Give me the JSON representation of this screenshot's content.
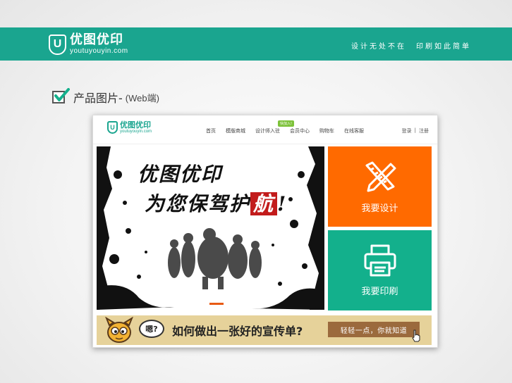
{
  "header": {
    "logo_mark": "U",
    "logo_cn": "优图优印",
    "logo_en": "youtuyouyin.com",
    "slogan_left": "设计无处不在",
    "slogan_right": "印刷如此简单",
    "color": "#1aa58f"
  },
  "section": {
    "title": "产品图片-",
    "subtitle": "(Web端)"
  },
  "inner_site": {
    "logo_cn": "优图优印",
    "logo_en": "youtuyouyin.com",
    "nav": [
      {
        "label": "首页"
      },
      {
        "label": "模版商城"
      },
      {
        "label": "设计师入驻",
        "badge": "快加入!"
      },
      {
        "label": "会员中心"
      },
      {
        "label": "购物车"
      },
      {
        "label": "在线客服"
      }
    ],
    "login": "登录",
    "divider": "|",
    "register": "注册",
    "banner": {
      "line1": "优图优印",
      "line2_prefix": "为您保驾护",
      "line2_highlight": "航",
      "line2_suffix": "!"
    },
    "tiles": [
      {
        "label": "我要设计",
        "icon": "ruler-pencil-icon",
        "color": "#ff6a00"
      },
      {
        "label": "我要印刷",
        "icon": "printer-icon",
        "color": "#13b08c"
      }
    ],
    "promo": {
      "bubble": "嗯?",
      "question": "如何做出一张好的宣传单?",
      "button": "轻轻一点，你就知道"
    }
  }
}
